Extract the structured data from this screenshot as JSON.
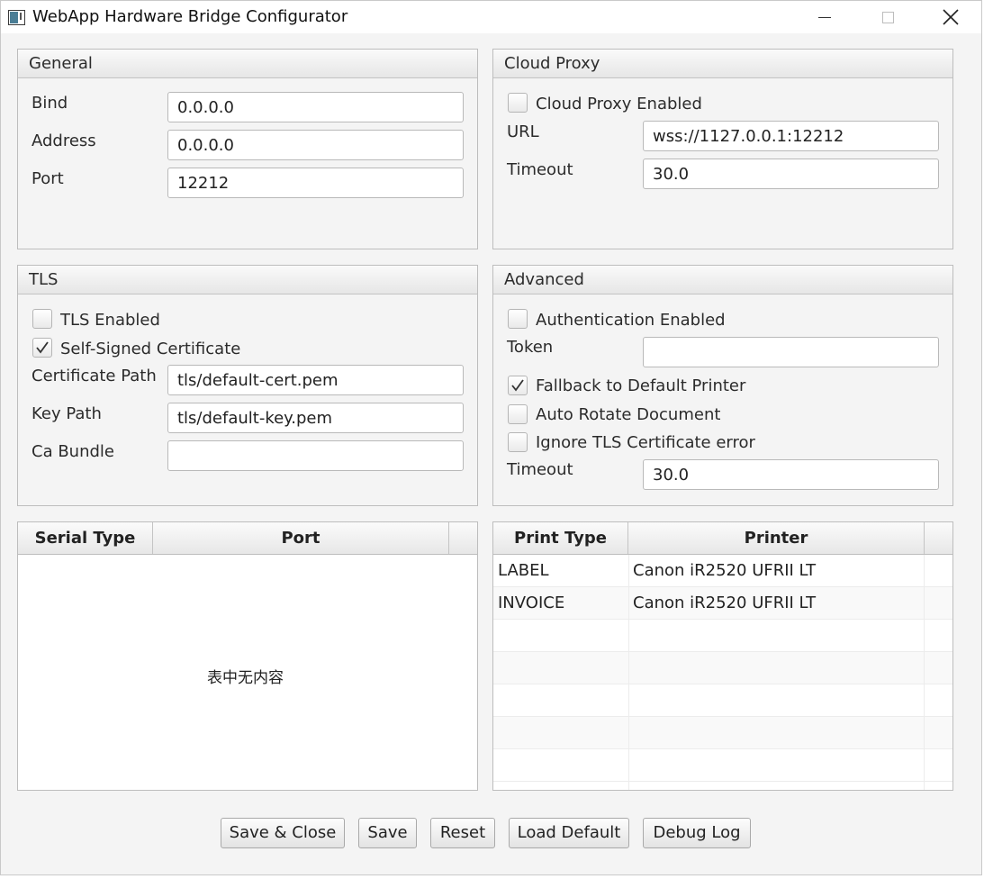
{
  "window": {
    "title": "WebApp Hardware Bridge Configurator"
  },
  "general": {
    "header": "General",
    "bind_label": "Bind",
    "bind_value": "0.0.0.0",
    "address_label": "Address",
    "address_value": "0.0.0.0",
    "port_label": "Port",
    "port_value": "12212"
  },
  "cloud_proxy": {
    "header": "Cloud Proxy",
    "enabled_label": "Cloud Proxy Enabled",
    "enabled": false,
    "url_label": "URL",
    "url_value": "wss://1127.0.0.1:12212",
    "timeout_label": "Timeout",
    "timeout_value": "30.0"
  },
  "tls": {
    "header": "TLS",
    "enabled_label": "TLS Enabled",
    "enabled": false,
    "self_signed_label": "Self-Signed Certificate",
    "self_signed": true,
    "cert_path_label": "Certificate Path",
    "cert_path_value": "tls/default-cert.pem",
    "key_path_label": "Key Path",
    "key_path_value": "tls/default-key.pem",
    "ca_bundle_label": "Ca Bundle",
    "ca_bundle_value": ""
  },
  "advanced": {
    "header": "Advanced",
    "auth_label": "Authentication Enabled",
    "auth_enabled": false,
    "token_label": "Token",
    "token_value": "",
    "fallback_label": "Fallback to Default Printer",
    "fallback_enabled": true,
    "auto_rotate_label": "Auto Rotate Document",
    "auto_rotate_enabled": false,
    "ignore_tls_label": "Ignore TLS Certificate error",
    "ignore_tls_enabled": false,
    "timeout_label": "Timeout",
    "timeout_value": "30.0"
  },
  "serial_table": {
    "columns": [
      "Serial Type",
      "Port"
    ],
    "empty_message": "表中无内容",
    "rows": []
  },
  "print_table": {
    "columns": [
      "Print Type",
      "Printer"
    ],
    "rows": [
      {
        "type": "LABEL",
        "printer": "Canon iR2520 UFRII LT"
      },
      {
        "type": "INVOICE",
        "printer": "Canon iR2520 UFRII LT"
      }
    ]
  },
  "buttons": {
    "save_close": "Save & Close",
    "save": "Save",
    "reset": "Reset",
    "load_default": "Load Default",
    "debug_log": "Debug Log"
  }
}
